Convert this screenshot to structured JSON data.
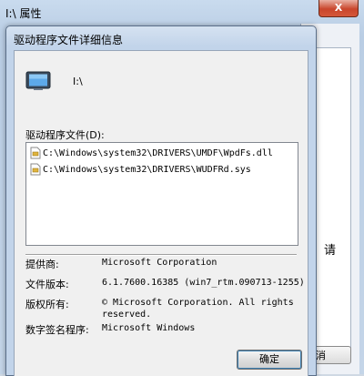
{
  "background_window": {
    "title": "I:\\ 属性",
    "close_label": "X",
    "partial_text": "请",
    "partial_button": "消"
  },
  "dialog": {
    "title": "驱动程序文件详细信息",
    "device_name": "I:\\",
    "files_label": "驱动程序文件(D):",
    "files": [
      "C:\\Windows\\system32\\DRIVERS\\UMDF\\WpdFs.dll",
      "C:\\Windows\\system32\\DRIVERS\\WUDFRd.sys"
    ],
    "details": {
      "provider_label": "提供商:",
      "provider_value": "Microsoft Corporation",
      "version_label": "文件版本:",
      "version_value": "6.1.7600.16385 (win7_rtm.090713-1255)",
      "copyright_label": "版权所有:",
      "copyright_line1": "© Microsoft Corporation. All rights",
      "copyright_line2": "reserved.",
      "signer_label": "数字签名程序:",
      "signer_value": "Microsoft Windows"
    },
    "ok_label": "确定"
  },
  "icons": {
    "device": "portable-device-icon",
    "file": "driver-file-icon"
  }
}
